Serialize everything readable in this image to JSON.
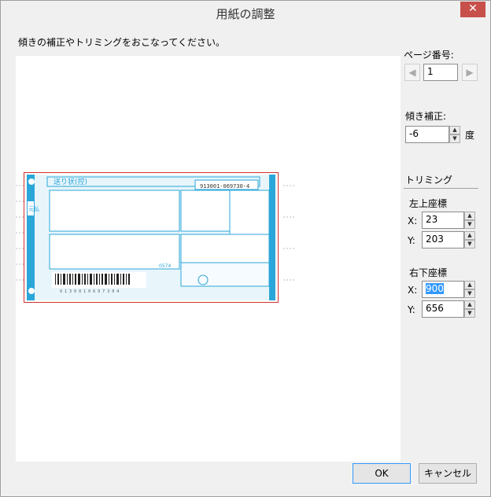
{
  "window": {
    "title": "用紙の調整",
    "close_glyph": "✕"
  },
  "instruction": "傾きの補正やトリミングをおこなってください。",
  "page_number": {
    "label": "ページ番号:",
    "value": "1"
  },
  "skew": {
    "label": "傾き補正:",
    "value": "-6",
    "unit": "度"
  },
  "trimming": {
    "label": "トリミング",
    "top_left": {
      "label": "左上座標",
      "x_label": "X:",
      "x": "23",
      "y_label": "Y:",
      "y": "203"
    },
    "bottom_right": {
      "label": "右下座標",
      "x_label": "X:",
      "x": "900",
      "y_label": "Y:",
      "y": "656"
    }
  },
  "buttons": {
    "ok": "OK",
    "cancel": "キャンセル"
  },
  "slip": {
    "title": "送り状(控)",
    "tracking": "913001-069730-4",
    "count_code": "0574",
    "barcode_digits": "9 1 3 0 0 1 0 6 9 7 3 0 4",
    "brand": "元払"
  },
  "colors": {
    "slip_blue": "#2aa6d9",
    "trim": "#d23030",
    "accent": "#3399ff"
  }
}
